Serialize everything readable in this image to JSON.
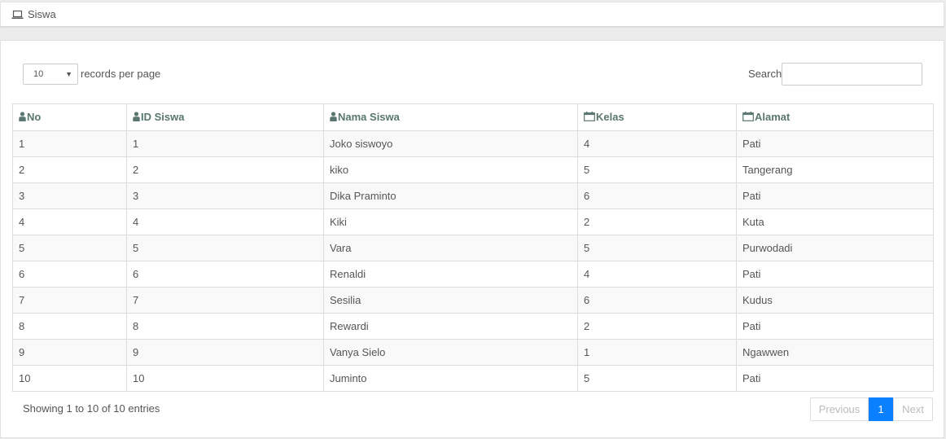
{
  "header": {
    "title": "Siswa",
    "icon": "laptop-icon"
  },
  "controls": {
    "page_length": "10",
    "length_label": "records per page",
    "search_label": "Search:",
    "search_value": ""
  },
  "table": {
    "columns": [
      {
        "label": "No",
        "icon": "user-icon"
      },
      {
        "label": "ID Siswa",
        "icon": "user-icon"
      },
      {
        "label": "Nama Siswa",
        "icon": "user-icon"
      },
      {
        "label": "Kelas",
        "icon": "calendar-icon"
      },
      {
        "label": "Alamat",
        "icon": "calendar-icon"
      }
    ],
    "rows": [
      [
        "1",
        "1",
        "Joko siswoyo",
        "4",
        "Pati"
      ],
      [
        "2",
        "2",
        "kiko",
        "5",
        "Tangerang"
      ],
      [
        "3",
        "3",
        "Dika Praminto",
        "6",
        "Pati"
      ],
      [
        "4",
        "4",
        "Kiki",
        "2",
        "Kuta"
      ],
      [
        "5",
        "5",
        "Vara",
        "5",
        "Purwodadi"
      ],
      [
        "6",
        "6",
        "Renaldi",
        "4",
        "Pati"
      ],
      [
        "7",
        "7",
        "Sesilia",
        "6",
        "Kudus"
      ],
      [
        "8",
        "8",
        "Rewardi",
        "2",
        "Pati"
      ],
      [
        "9",
        "9",
        "Vanya Sielo",
        "1",
        "Ngawwen"
      ],
      [
        "10",
        "10",
        "Juminto",
        "5",
        "Pati"
      ]
    ]
  },
  "footer": {
    "info": "Showing 1 to 10 of 10 entries",
    "pagination": {
      "previous": "Previous",
      "current": "1",
      "next": "Next"
    }
  },
  "colors": {
    "header_text": "#5a7670",
    "accent": "#0a80ff"
  }
}
